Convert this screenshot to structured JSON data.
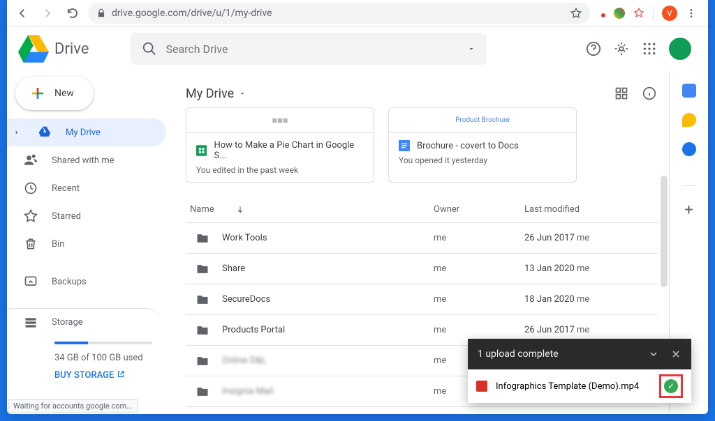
{
  "url": "drive.google.com/drive/u/1/my-drive",
  "app_name": "Drive",
  "search": {
    "placeholder": "Search Drive"
  },
  "new_button": "New",
  "nav": {
    "my_drive": "My Drive",
    "shared": "Shared with me",
    "recent": "Recent",
    "starred": "Starred",
    "bin": "Bin",
    "backups": "Backups",
    "storage": "Storage"
  },
  "storage": {
    "used_text": "34 GB of 100 GB used",
    "buy": "BUY STORAGE",
    "percent": 34
  },
  "path": "My Drive",
  "cards": [
    {
      "title": "How to Make a Pie Chart in Google S...",
      "sub": "You edited in the past week",
      "icon": "sheets"
    },
    {
      "title": "Brochure - covert to Docs",
      "sub": "You opened it yesterday",
      "icon": "docs",
      "preview": "Product Brochure"
    }
  ],
  "columns": {
    "name": "Name",
    "owner": "Owner",
    "modified": "Last modified"
  },
  "rows": [
    {
      "name": "Work Tools",
      "owner": "me",
      "modified": "26 Jun 2017",
      "mod_owner": "me"
    },
    {
      "name": "Share",
      "owner": "me",
      "modified": "13 Jan 2020",
      "mod_owner": "me"
    },
    {
      "name": "SecureDocs",
      "owner": "me",
      "modified": "18 Jan 2020",
      "mod_owner": "me"
    },
    {
      "name": "Products Portal",
      "owner": "me",
      "modified": "26 Jun 2017",
      "mod_owner": "me"
    },
    {
      "name": "Online D&L",
      "owner": "me",
      "modified": "",
      "mod_owner": "",
      "blur": true
    },
    {
      "name": "Insignia Mail",
      "owner": "me",
      "modified": "",
      "mod_owner": "",
      "blur": true
    }
  ],
  "upload": {
    "header": "1 upload complete",
    "file": "Infographics Template (Demo).mp4"
  },
  "status": "Waiting for accounts.google.com...",
  "profile_initial": "V"
}
